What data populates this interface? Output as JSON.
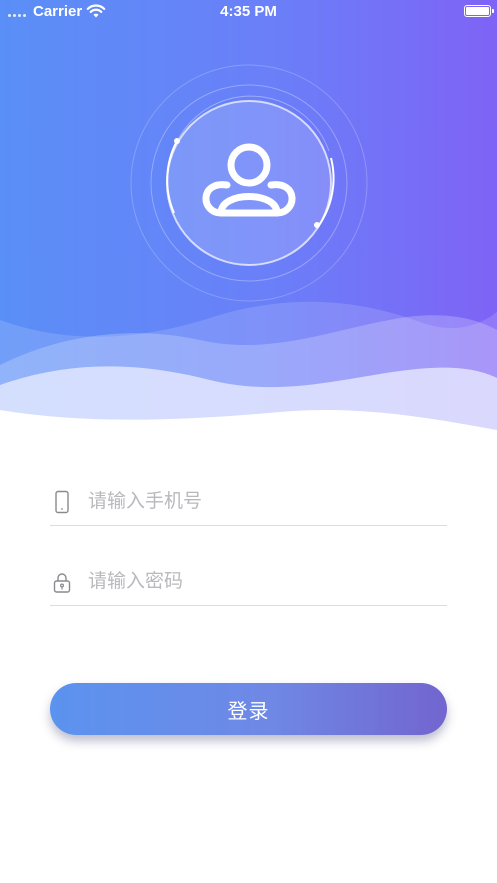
{
  "status_bar": {
    "carrier": "Carrier",
    "time": "4:35 PM"
  },
  "icons": {
    "avatar": "user-icon",
    "phone": "phone-icon",
    "password": "lock-icon",
    "wifi": "wifi-icon",
    "battery": "battery-icon",
    "signal": "signal-icon"
  },
  "colors": {
    "gradient_start": "#5a8ff7",
    "gradient_end": "#7f63f6",
    "button_start": "#5b93ef",
    "button_end": "#7265cf",
    "placeholder": "#b9b9bd"
  },
  "form": {
    "phone_placeholder": "请输入手机号",
    "phone_value": "",
    "password_placeholder": "请输入密码",
    "password_value": "",
    "login_label": "登录"
  }
}
